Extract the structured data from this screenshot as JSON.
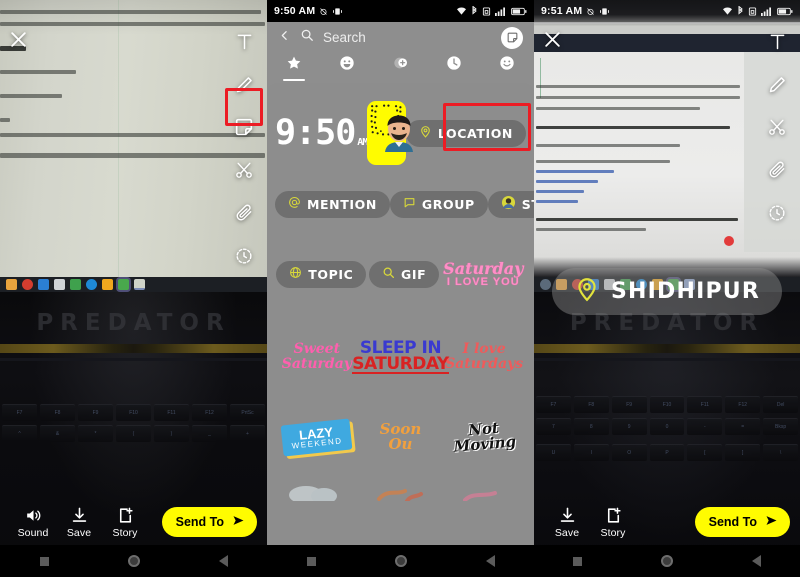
{
  "panels": {
    "left": {
      "status_time": "",
      "doc_text_lines": [
        ", you …  … it is not difficult, and anyone can do … …ting a",
        "…s and creating a geotag on Snapchat, you can check out the steps under the",
        "hat",
        "following these steps:",
        "our smartphone.",
        "swiping right or adding a text by tapping on your snap or the video that you ha",
        "your snap, you have to click on the sticker icon at the top right of the screen"
      ],
      "doc_footer": "Last edited by adityaNarvad on Jan",
      "laptop_brand": "PREDATOR",
      "tools": [
        {
          "name": "close-icon",
          "label": "Close"
        },
        {
          "name": "text-tool-icon",
          "label": "Text"
        },
        {
          "name": "draw-tool-icon",
          "label": "Draw"
        },
        {
          "name": "sticker-tool-icon",
          "label": "Stickers"
        },
        {
          "name": "scissors-tool-icon",
          "label": "Scissors"
        },
        {
          "name": "paperclip-tool-icon",
          "label": "Attach link"
        },
        {
          "name": "timer-tool-icon",
          "label": "Timer"
        }
      ],
      "highlight": "sticker-tool-icon",
      "actions": [
        {
          "name": "sound-button",
          "label": "Sound",
          "icon": "speaker-icon"
        },
        {
          "name": "save-button",
          "label": "Save",
          "icon": "download-icon"
        },
        {
          "name": "story-button",
          "label": "Story",
          "icon": "add-story-icon"
        }
      ],
      "send_to": "Send To"
    },
    "middle": {
      "status_time": "9:50 AM",
      "search_placeholder": "Search",
      "back_icon": "chevron-left-icon",
      "tabs": [
        {
          "name": "tab-favorites",
          "icon": "star-icon",
          "active": true
        },
        {
          "name": "tab-emoji",
          "icon": "smiley-icon",
          "active": false
        },
        {
          "name": "tab-bitmoji",
          "icon": "bitmoji-icon",
          "active": false
        },
        {
          "name": "tab-recent",
          "icon": "clock-icon",
          "active": false
        },
        {
          "name": "tab-emoji-2",
          "icon": "smiley-face-icon",
          "active": false
        }
      ],
      "row1": [
        {
          "name": "time-sticker",
          "type": "clock",
          "time": "9:50",
          "ampm": "AM"
        },
        {
          "name": "snapcode-sticker",
          "type": "snapcode"
        },
        {
          "name": "location-sticker-button",
          "type": "pill",
          "label": "LOCATION",
          "icon": "location-pin-icon"
        }
      ],
      "row2": [
        {
          "name": "mention-sticker-button",
          "label": "MENTION",
          "icon": "at-icon"
        },
        {
          "name": "group-sticker-button",
          "label": "GROUP",
          "icon": "chat-icon"
        },
        {
          "name": "story-sticker-button",
          "label": "STORY",
          "icon": "bitmoji-avatar-icon"
        }
      ],
      "row3": [
        {
          "name": "topic-sticker-button",
          "label": "TOPIC",
          "icon": "globe-icon"
        },
        {
          "name": "gif-sticker-button",
          "label": "GIF",
          "icon": "search-icon"
        },
        {
          "name": "saturday-love-sticker",
          "label": "Saturday",
          "sub": "I LOVE YOU"
        }
      ],
      "row4": [
        {
          "name": "sweet-saturday-sticker",
          "l1": "Sweet",
          "l2": "Saturday"
        },
        {
          "name": "sleep-in-saturday-sticker",
          "l1": "SLEEP IN",
          "l2": "SATURDAY"
        },
        {
          "name": "love-saturdays-sticker",
          "l1": "I love",
          "l2": "Saturdays"
        }
      ],
      "row5": [
        {
          "name": "lazy-weekend-sticker",
          "l1": "LAZY",
          "l2": "WEEKEND"
        },
        {
          "name": "soon-sticker",
          "l1": "Soon",
          "l2": "Ou"
        },
        {
          "name": "not-moving-sticker",
          "l1": "Not",
          "l2": "Moving"
        }
      ],
      "highlight": "location-sticker-button"
    },
    "right": {
      "status_time": "9:51 AM",
      "location_sticker": "SHIDHIPUR",
      "location_icon": "location-pin-icon",
      "tools": [
        {
          "name": "close-icon",
          "label": "Close"
        },
        {
          "name": "text-tool-icon",
          "label": "Text"
        },
        {
          "name": "draw-tool-icon",
          "label": "Draw"
        },
        {
          "name": "scissors-tool-icon",
          "label": "Scissors"
        },
        {
          "name": "paperclip-tool-icon",
          "label": "Attach link"
        },
        {
          "name": "timer-tool-icon",
          "label": "Timer"
        }
      ],
      "actions": [
        {
          "name": "save-button",
          "label": "Save",
          "icon": "download-icon"
        },
        {
          "name": "story-button",
          "label": "Story",
          "icon": "add-story-icon"
        }
      ],
      "send_to": "Send To",
      "laptop_brand": "PREDATOR"
    }
  },
  "colors": {
    "snap_yellow": "#fffc00",
    "highlight_red": "#ec1c24",
    "picker_grey": "#8e8e8e",
    "pill_grey": "#6f6f6f"
  },
  "statusbar_icons": [
    "alarm-off-icon",
    "vibrate-icon",
    "wifi-icon",
    "bluetooth-icon",
    "sim-icon",
    "signal-icon",
    "battery-icon"
  ]
}
